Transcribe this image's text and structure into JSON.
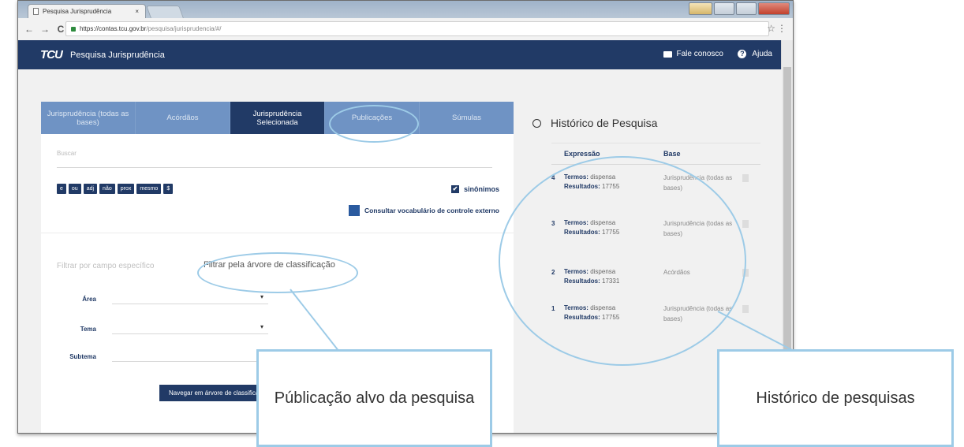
{
  "browser": {
    "tab_title": "Pesquisa Jurisprudência",
    "tab_close": "×",
    "url_host": "https://contas.tcu.gov.br",
    "url_path": "/pesquisa/jurisprudencia/#/",
    "back_icon": "←",
    "forward_icon": "→",
    "reload_icon": "C",
    "star_icon": "☆",
    "menu_icon": "⋮"
  },
  "app": {
    "logo": "TCU",
    "title": "Pesquisa Jurisprudência",
    "contact": "Fale conosco",
    "help": "Ajuda",
    "help_glyph": "?"
  },
  "tabs": [
    {
      "label": "Jurisprudência (todas as bases)",
      "active": false
    },
    {
      "label": "Acórdãos",
      "active": false
    },
    {
      "label": "Jurisprudência Selecionada",
      "active": true
    },
    {
      "label": "Publicações",
      "active": false
    },
    {
      "label": "Súmulas",
      "active": false
    }
  ],
  "search": {
    "placeholder": "Buscar",
    "operators": [
      "e",
      "ou",
      "adj",
      "não",
      "prox",
      "mesmo",
      "$"
    ],
    "synonyms_label": "sinônimos",
    "check_glyph": "✔",
    "vocab_link": "Consultar vocabulário de controle externo"
  },
  "filters": {
    "by_field": "Filtrar por campo específico",
    "by_tree": "Filtrar pela árvore de classificação",
    "area_label": "Área",
    "tema_label": "Tema",
    "subtema_label": "Subtema",
    "dropdown_glyph": "▾",
    "navigate_button": "Navegar em árvore de classificação"
  },
  "history": {
    "title": "Histórico de Pesquisa",
    "col_expression": "Expressão",
    "col_base": "Base",
    "terms_label": "Termos:",
    "results_label": "Resultados:",
    "rows": [
      {
        "num": "4",
        "terms": "dispensa",
        "results": "17755",
        "base": "Jurisprudência (todas as bases)"
      },
      {
        "num": "3",
        "terms": "dispensa",
        "results": "17755",
        "base": "Jurisprudência (todas as bases)"
      },
      {
        "num": "2",
        "terms": "dispensa",
        "results": "17331",
        "base": "Acórdãos"
      },
      {
        "num": "1",
        "terms": "dispensa",
        "results": "17755",
        "base": "Jurisprudência (todas as bases)"
      }
    ]
  },
  "callouts": {
    "left": "Públicação alvo da pesquisa",
    "right": "Histórico de pesquisas"
  },
  "colors": {
    "header": "#213a66",
    "tab_inactive": "#6f93c4",
    "annotation": "#9dcbe7"
  }
}
